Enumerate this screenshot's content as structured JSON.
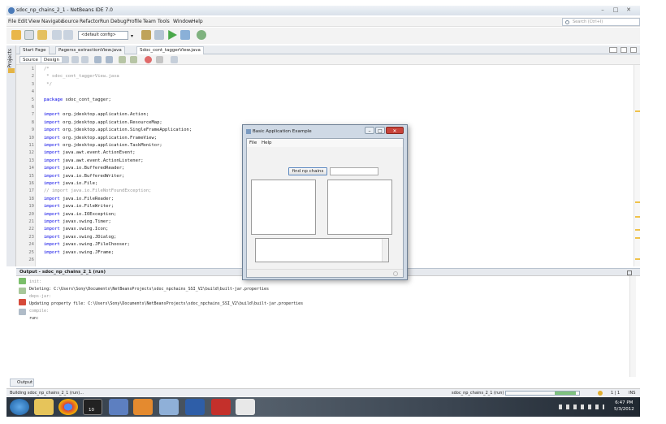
{
  "window": {
    "title": "sdoc_np_chains_2_1 - NetBeans IDE 7.0",
    "controls": [
      "–",
      "□",
      "✕"
    ]
  },
  "menu": {
    "items": [
      "File",
      "Edit",
      "View",
      "Navigate",
      "Source",
      "Refactor",
      "Run",
      "Debug",
      "Profile",
      "Team",
      "Tools",
      "Window",
      "Help"
    ],
    "search_placeholder": "Search (Ctrl+I)"
  },
  "toolbar": {
    "config_value": "<default config>"
  },
  "side_strip": {
    "label": "Projects"
  },
  "editor": {
    "tabs": [
      "Start Page",
      "Pagerss_extractionView.java",
      "Sdoc_cont_taggerView.java"
    ],
    "view_buttons": [
      "Source",
      "Design"
    ],
    "line_numbers": [
      "1",
      "2",
      "3",
      "4",
      "5",
      "6",
      "7",
      "8",
      "9",
      "10",
      "11",
      "12",
      "13",
      "14",
      "15",
      "16",
      "17",
      "18",
      "19",
      "20",
      "21",
      "22",
      "23",
      "24",
      "25",
      "26"
    ],
    "lines": [
      {
        "kw": "",
        "text": "/*"
      },
      {
        "kw": "",
        "text": " * sdoc_cont_taggerView.java"
      },
      {
        "kw": "",
        "text": " */"
      },
      {
        "kw": "",
        "text": ""
      },
      {
        "kw": "package",
        "text": " sdoc_cont_tagger;"
      },
      {
        "kw": "",
        "text": ""
      },
      {
        "kw": "import",
        "text": " org.jdesktop.application.Action;"
      },
      {
        "kw": "import",
        "text": " org.jdesktop.application.ResourceMap;"
      },
      {
        "kw": "import",
        "text": " org.jdesktop.application.SingleFrameApplication;"
      },
      {
        "kw": "import",
        "text": " org.jdesktop.application.FrameView;"
      },
      {
        "kw": "import",
        "text": " org.jdesktop.application.TaskMonitor;"
      },
      {
        "kw": "import",
        "text": " java.awt.event.ActionEvent;"
      },
      {
        "kw": "import",
        "text": " java.awt.event.ActionListener;"
      },
      {
        "kw": "import",
        "text": " java.io.BufferedReader;"
      },
      {
        "kw": "import",
        "text": " java.io.BufferedWriter;"
      },
      {
        "kw": "import",
        "text": " java.io.File;"
      },
      {
        "kw": "",
        "text": "// import java.io.FileNotFoundException;"
      },
      {
        "kw": "import",
        "text": " java.io.FileReader;"
      },
      {
        "kw": "import",
        "text": " java.io.FileWriter;"
      },
      {
        "kw": "import",
        "text": " java.io.IOException;"
      },
      {
        "kw": "import",
        "text": " javax.swing.Timer;"
      },
      {
        "kw": "import",
        "text": " javax.swing.Icon;"
      },
      {
        "kw": "import",
        "text": " javax.swing.JDialog;"
      },
      {
        "kw": "import",
        "text": " javax.swing.JFileChooser;"
      },
      {
        "kw": "import",
        "text": " javax.swing.JFrame;"
      },
      {
        "kw": "",
        "text": ""
      }
    ]
  },
  "output": {
    "title": "Output - sdoc_np_chains_2_1 (run)",
    "lines": [
      {
        "style": "gray",
        "text": "init:"
      },
      {
        "style": "",
        "text": "Deleting: C:\\Users\\Sony\\Documents\\NetBeansProjects\\sdoc_npchains_SSI_V2\\build\\built-jar.properties"
      },
      {
        "style": "gray",
        "text": "deps-jar:"
      },
      {
        "style": "",
        "text": "Updating property file: C:\\Users\\Sony\\Documents\\NetBeansProjects\\sdoc_npchains_SSI_V2\\build\\built-jar.properties"
      },
      {
        "style": "gray",
        "text": "compile:"
      },
      {
        "style": "",
        "text": "run:"
      }
    ],
    "tab_label": "Output"
  },
  "status": {
    "left": "Building sdoc_np_chains_2_1 (run)...",
    "task": "sdoc_np_chains_2_1 (run)",
    "position": "1 | 1",
    "mode": "INS"
  },
  "taskbar": {
    "time": "6:47 PM",
    "date": "5/3/2012",
    "badge": "10"
  },
  "dialog": {
    "title": "Basic Application Example",
    "menu": [
      "File",
      "Help"
    ],
    "button_label": "find np chains",
    "input_value": "",
    "controls": [
      "–",
      "□",
      "✕"
    ]
  },
  "colors": {
    "keyword": "#0000e6",
    "comment": "#9a9a9a",
    "close_button": "#c8433a"
  }
}
